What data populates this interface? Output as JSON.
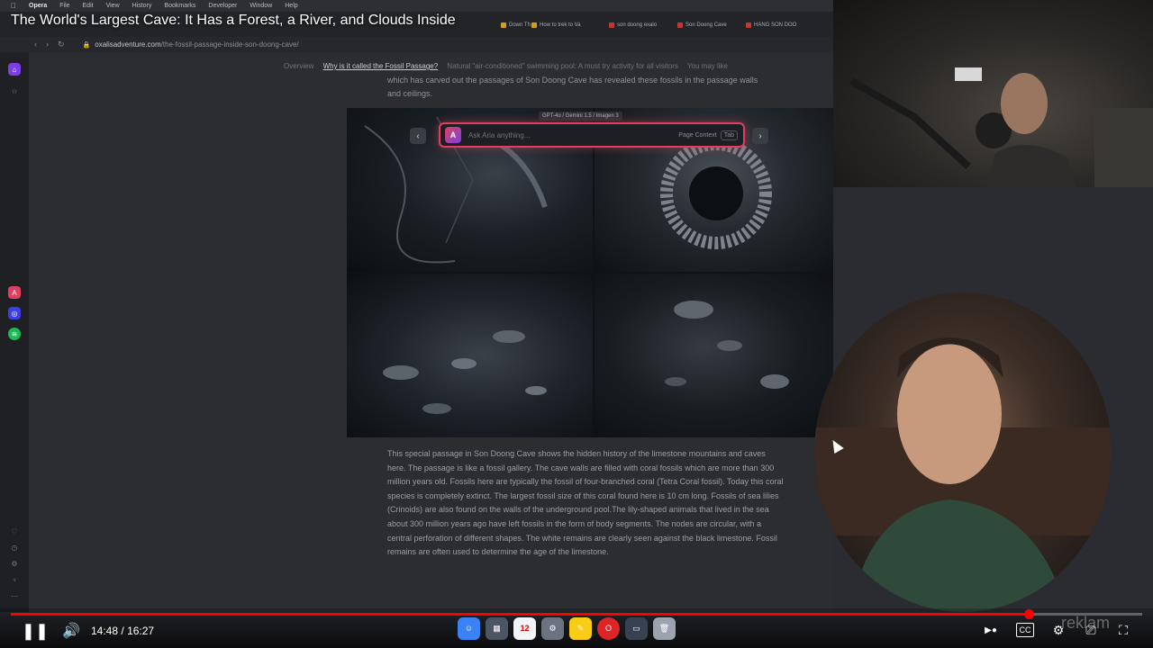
{
  "video": {
    "title": "The World's Largest Cave: It Has a Forest, a River, and Clouds Inside",
    "current_time": "14:48",
    "separator": "/",
    "duration": "16:27",
    "progress_fraction": 0.9,
    "watermark": "reklam"
  },
  "menubar": {
    "app": "Opera",
    "items": [
      "File",
      "Edit",
      "View",
      "History",
      "Bookmarks",
      "Developer",
      "Window",
      "Help"
    ]
  },
  "browser": {
    "tabs": [
      "Down Th",
      "How to trek to Va",
      "son doong exalo",
      "Son Doong Cave",
      "HANG SON DOO"
    ],
    "url_domain": "oxalisadventure.com",
    "url_path": "/the-fossil-passage-inside-son-doong-cave/"
  },
  "toc": {
    "items": [
      "Overview",
      "Why is it called the Fossil Passage?",
      "Natural \"air-conditioned\" swimming pool: A must try activity for all visitors",
      "You may like"
    ]
  },
  "page": {
    "faded_text": "which has carved out the passages of Son Doong Cave has revealed these fossils in the passage walls and ceilings.",
    "paragraph": "This special passage in Son Doong Cave shows the hidden history of the limestone mountains and caves here. The passage is like a fossil gallery. The cave walls are filled with coral fossils which are more than 300 million years old. Fossils here are typically the fossil of four-branched coral (Tetra Coral fossil). Today this coral species is completely extinct. The largest fossil size of this coral found here is 10 cm long. Fossils of sea lilies (Crinoids) are also found on the walls of the underground pool.The lily-shaped animals that lived in the sea about 300 million years ago have left fossils in the form of body segments. The nodes are circular, with a central perforation of different shapes. The white remains are clearly seen against the black limestone. Fossil remains are often used to determine the age of the limestone."
  },
  "aria": {
    "model_badge": "GPT-4o / Gemini 1.5 / Imagen 3",
    "placeholder": "Ask Aria anything...",
    "context_label": "Page Context",
    "tab_key": "Tab",
    "prev": "‹",
    "next": "›"
  },
  "dock": {
    "calendar_day": "12"
  },
  "colors": {
    "accent_red": "#ff0000",
    "aria_border": "#e0405f"
  }
}
